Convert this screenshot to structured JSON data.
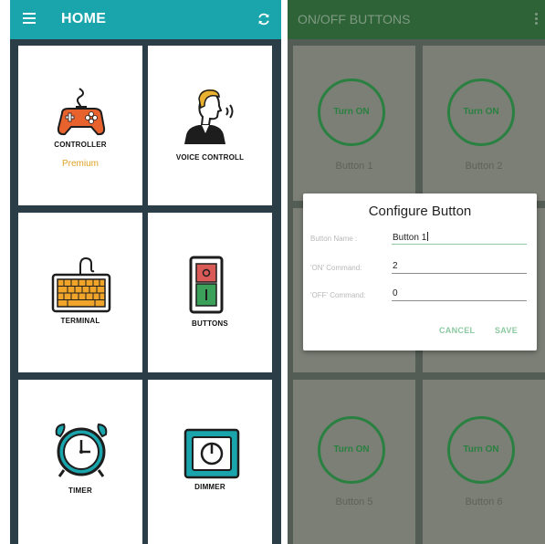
{
  "home": {
    "title": "HOME",
    "icons": {
      "menu": "hamburger-menu-icon",
      "refresh": "refresh-icon"
    },
    "tiles": [
      {
        "label": "CONTROLLER",
        "sub": "Premium",
        "icon": "gamepad-icon"
      },
      {
        "label": "VOICE CONTROLL",
        "icon": "voice-person-icon"
      },
      {
        "label": "TERMINAL",
        "icon": "keyboard-icon"
      },
      {
        "label": "BUTTONS",
        "icon": "switch-icon"
      },
      {
        "label": "TIMER",
        "icon": "alarm-clock-icon"
      },
      {
        "label": "DIMMER",
        "icon": "dimmer-knob-icon"
      }
    ],
    "colors": {
      "accent": "#1aa5ac",
      "premium": "#e0a126",
      "background": "#2b3d47"
    }
  },
  "buttons_screen": {
    "title": "ON/OFF BUTTONS",
    "icons": {
      "more": "more-vert-icon"
    },
    "cells": [
      {
        "ring": "Turn ON",
        "caption": "Button 1"
      },
      {
        "ring": "Turn ON",
        "caption": "Button 2"
      },
      {
        "ring": "Turn ON",
        "caption": "Button 5"
      },
      {
        "ring": "Turn ON",
        "caption": "Button 6"
      }
    ],
    "colors": {
      "appbar": "#2e6337",
      "ring": "#2a8040"
    }
  },
  "dialog": {
    "title": "Configure Button",
    "fields": [
      {
        "label": "Button Name :",
        "value": "Button 1"
      },
      {
        "label": "'ON' Command:",
        "value": "2"
      },
      {
        "label": "'OFF' Command:",
        "value": "0"
      }
    ],
    "cancel": "CANCEL",
    "save": "SAVE",
    "colors": {
      "action": "#8cc9a0"
    }
  }
}
